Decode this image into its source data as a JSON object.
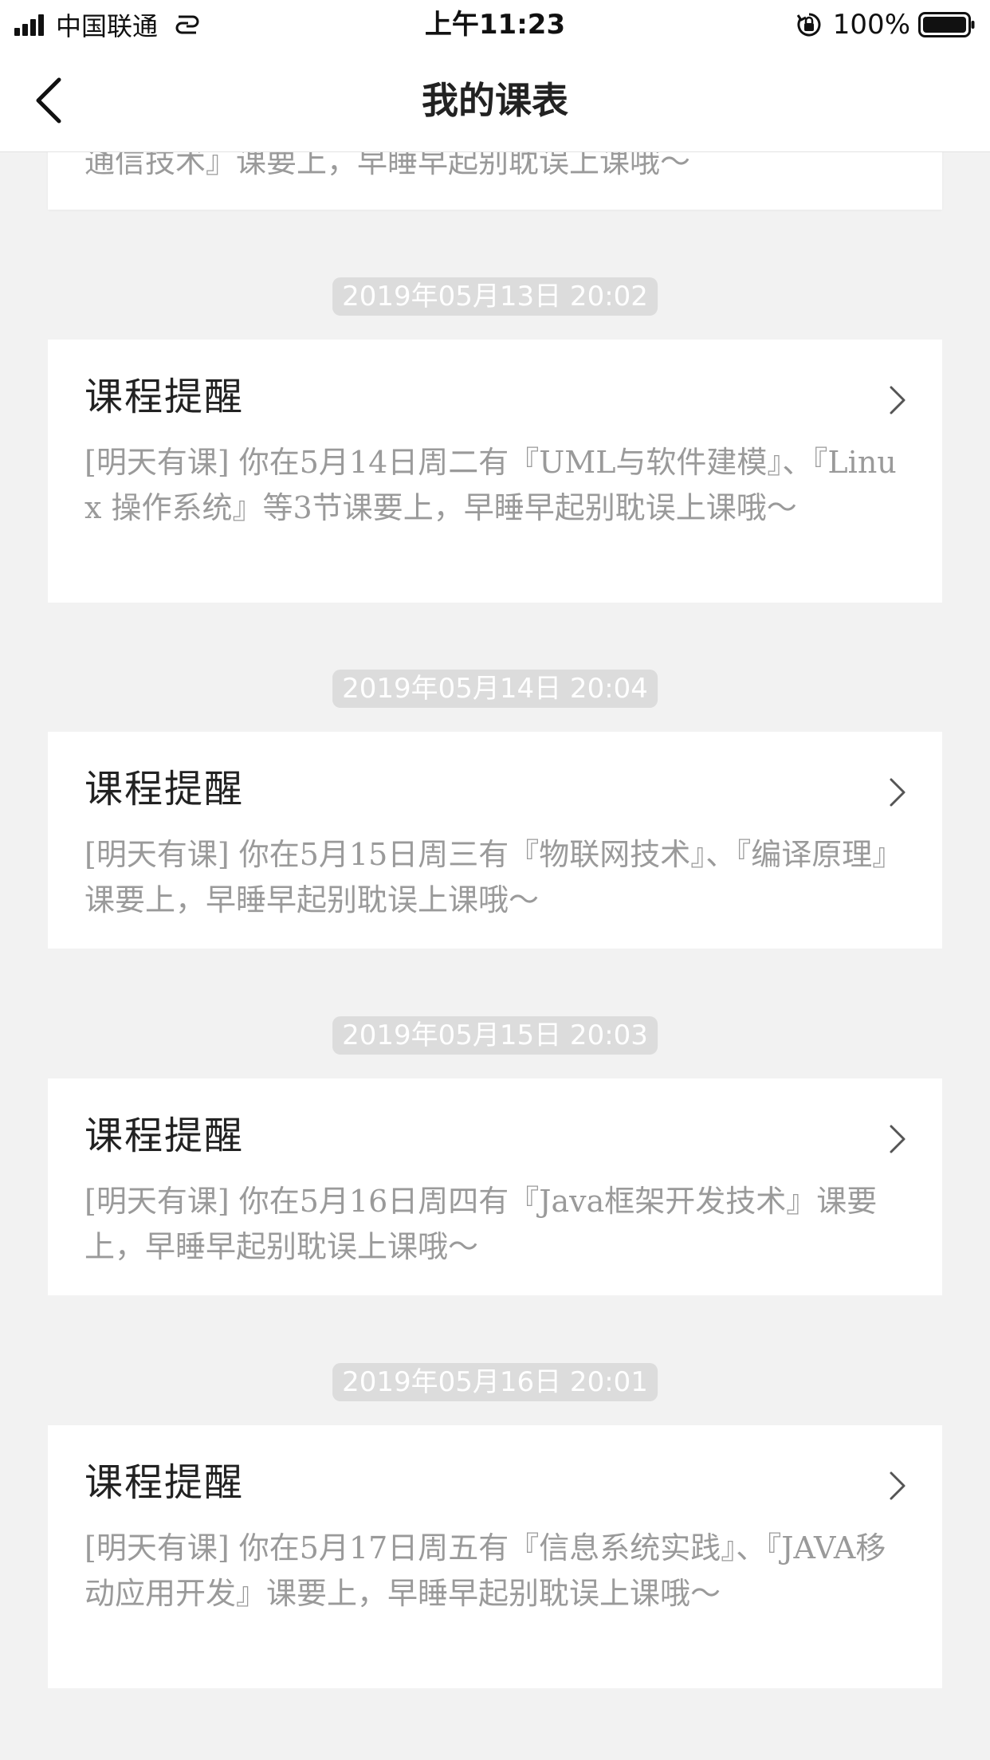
{
  "status_bar": {
    "carrier": "中国联通",
    "time": "上午11:23",
    "battery": "100%"
  },
  "nav": {
    "title": "我的课表"
  },
  "partial_card": {
    "body": "通信技术』课要上，早睡早起别耽误上课哦～"
  },
  "messages": [
    {
      "date": "2019年05月13日 20:02",
      "title": "课程提醒",
      "body": "[明天有课] 你在5月14日周二有『UML与软件建模』、『Linux 操作系统』等3节课要上，早睡早起别耽误上课哦～"
    },
    {
      "date": "2019年05月14日 20:04",
      "title": "课程提醒",
      "body": "[明天有课] 你在5月15日周三有『物联网技术』、『编译原理』课要上，早睡早起别耽误上课哦～"
    },
    {
      "date": "2019年05月15日 20:03",
      "title": "课程提醒",
      "body": "[明天有课] 你在5月16日周四有『Java框架开发技术』课要上，早睡早起别耽误上课哦～"
    },
    {
      "date": "2019年05月16日 20:01",
      "title": "课程提醒",
      "body": "[明天有课] 你在5月17日周五有『信息系统实践』、『JAVA移动应用开发』课要上，早睡早起别耽误上课哦～"
    }
  ],
  "colors": {
    "background": "#f2f2f2",
    "card": "#ffffff",
    "body_text": "#9a9a9a",
    "pill": "#dcdcdc"
  },
  "icons": {
    "back": "chevron-left-icon",
    "card_arrow": "chevron-right-icon",
    "signal": "signal-bars-icon",
    "hotspot": "link-icon",
    "orientation_lock": "orientation-lock-icon",
    "battery": "battery-icon"
  }
}
